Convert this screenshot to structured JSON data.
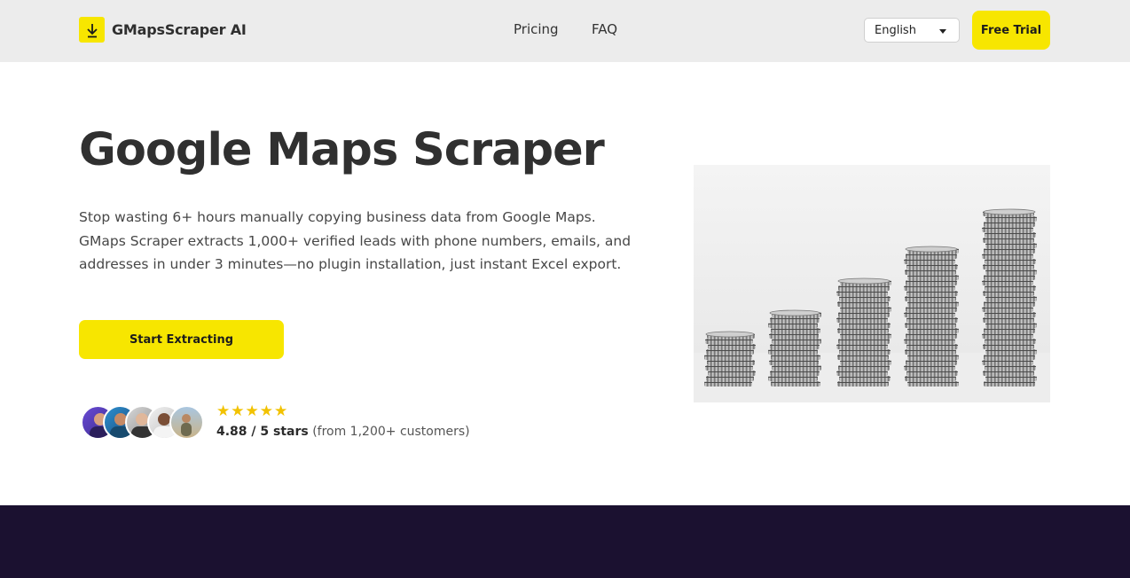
{
  "header": {
    "brand": "GMapsScraper AI",
    "nav": [
      {
        "label": "Pricing"
      },
      {
        "label": "FAQ"
      }
    ],
    "language_select": {
      "selected": "English"
    },
    "trial_button": "Free Trial"
  },
  "hero": {
    "title": "Google Maps Scraper",
    "description": "Stop wasting 6+ hours manually copying business data from Google Maps. GMaps Scraper extracts 1,000+ verified leads with phone numbers, emails, and addresses in under 3 minutes—no plugin installation, just instant Excel export.",
    "cta": "Start Extracting",
    "rating": {
      "stars": 5,
      "score": "4.88 / 5 stars",
      "note": "(from 1,200+ customers)"
    }
  },
  "colors": {
    "accent": "#f7e600",
    "header_bg": "#ececec",
    "dark_section": "#1b1130",
    "star": "#f2c200"
  },
  "icons": {
    "logo": "download-arrow-icon",
    "language_caret": "caret-down-icon",
    "rating_star": "star-icon"
  }
}
